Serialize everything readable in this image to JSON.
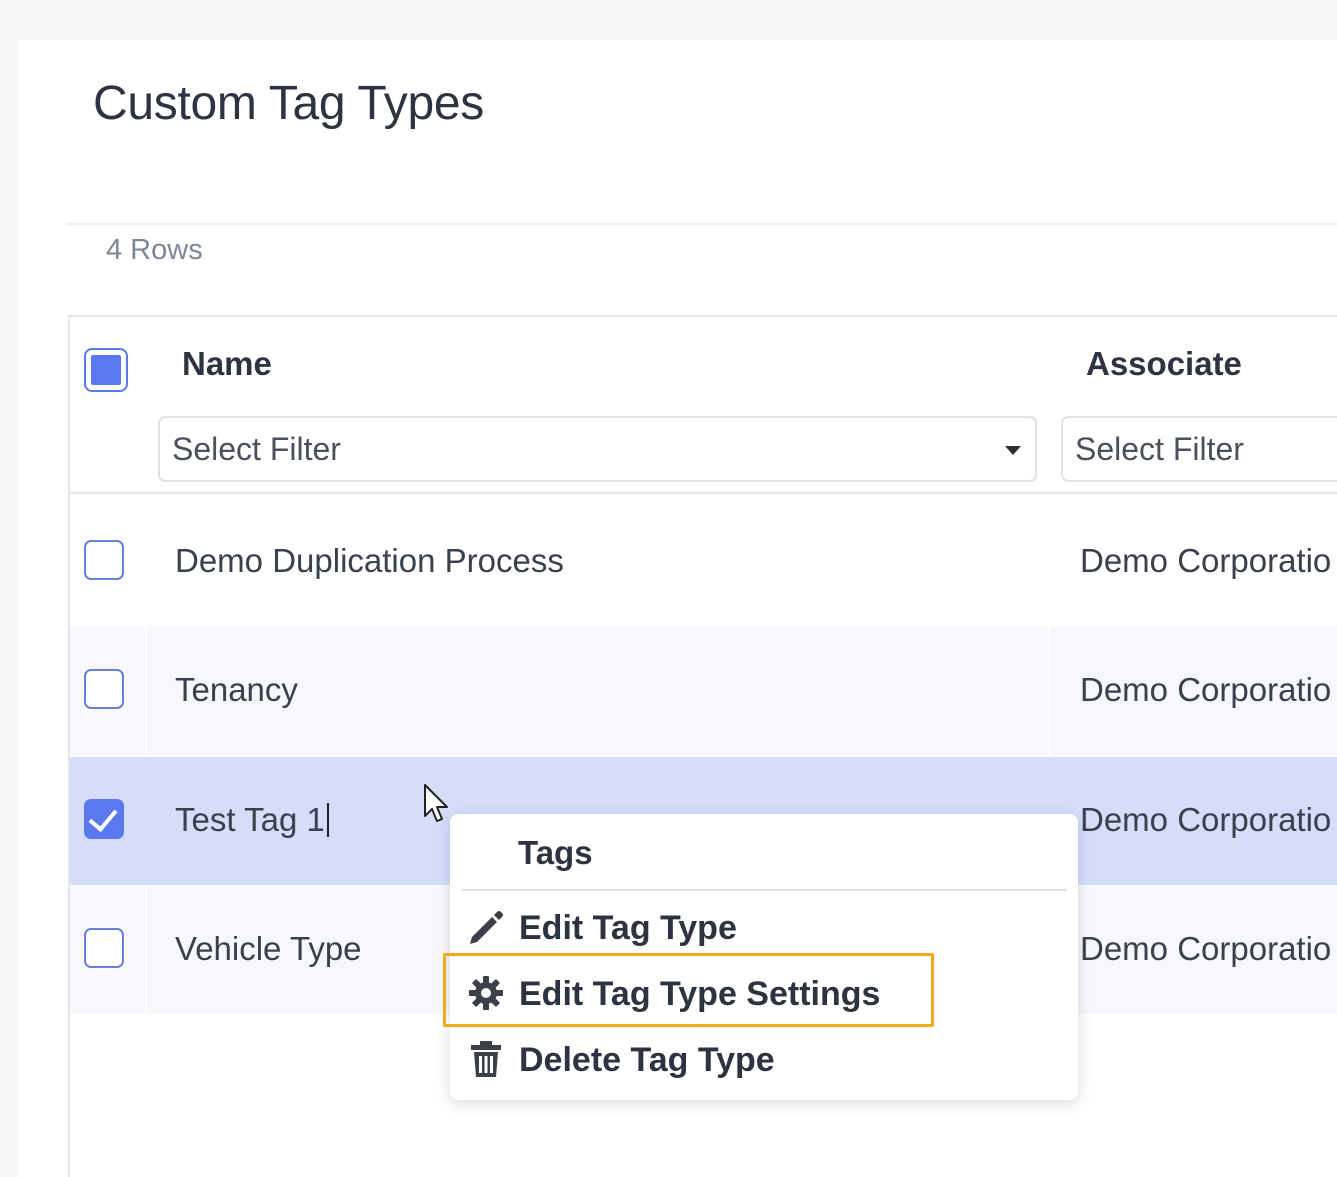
{
  "page": {
    "title": "Custom Tag Types",
    "rows_count": "4 Rows"
  },
  "table": {
    "columns": [
      {
        "label": "Name",
        "filter_placeholder": "Select Filter"
      },
      {
        "label": "Associate",
        "filter_placeholder": "Select Filter"
      }
    ],
    "rows": [
      {
        "name": "Demo Duplication Process",
        "associate": "Demo Corporatio",
        "checked": false
      },
      {
        "name": "Tenancy",
        "associate": "Demo Corporatio",
        "checked": false
      },
      {
        "name": "Test Tag 1",
        "associate": "Demo Corporatio",
        "checked": true
      },
      {
        "name": "Vehicle Type",
        "associate": "Demo Corporatio",
        "checked": false
      }
    ]
  },
  "context_menu": {
    "title": "Tags",
    "items": [
      {
        "label": "Edit Tag Type",
        "icon": "pencil-icon"
      },
      {
        "label": "Edit Tag Type Settings",
        "icon": "gear-icon"
      },
      {
        "label": "Delete Tag Type",
        "icon": "trash-icon"
      }
    ]
  },
  "colors": {
    "accent": "#5a78f0",
    "selected_row": "#d6ddfb",
    "highlight_border": "#f2ab1c"
  }
}
